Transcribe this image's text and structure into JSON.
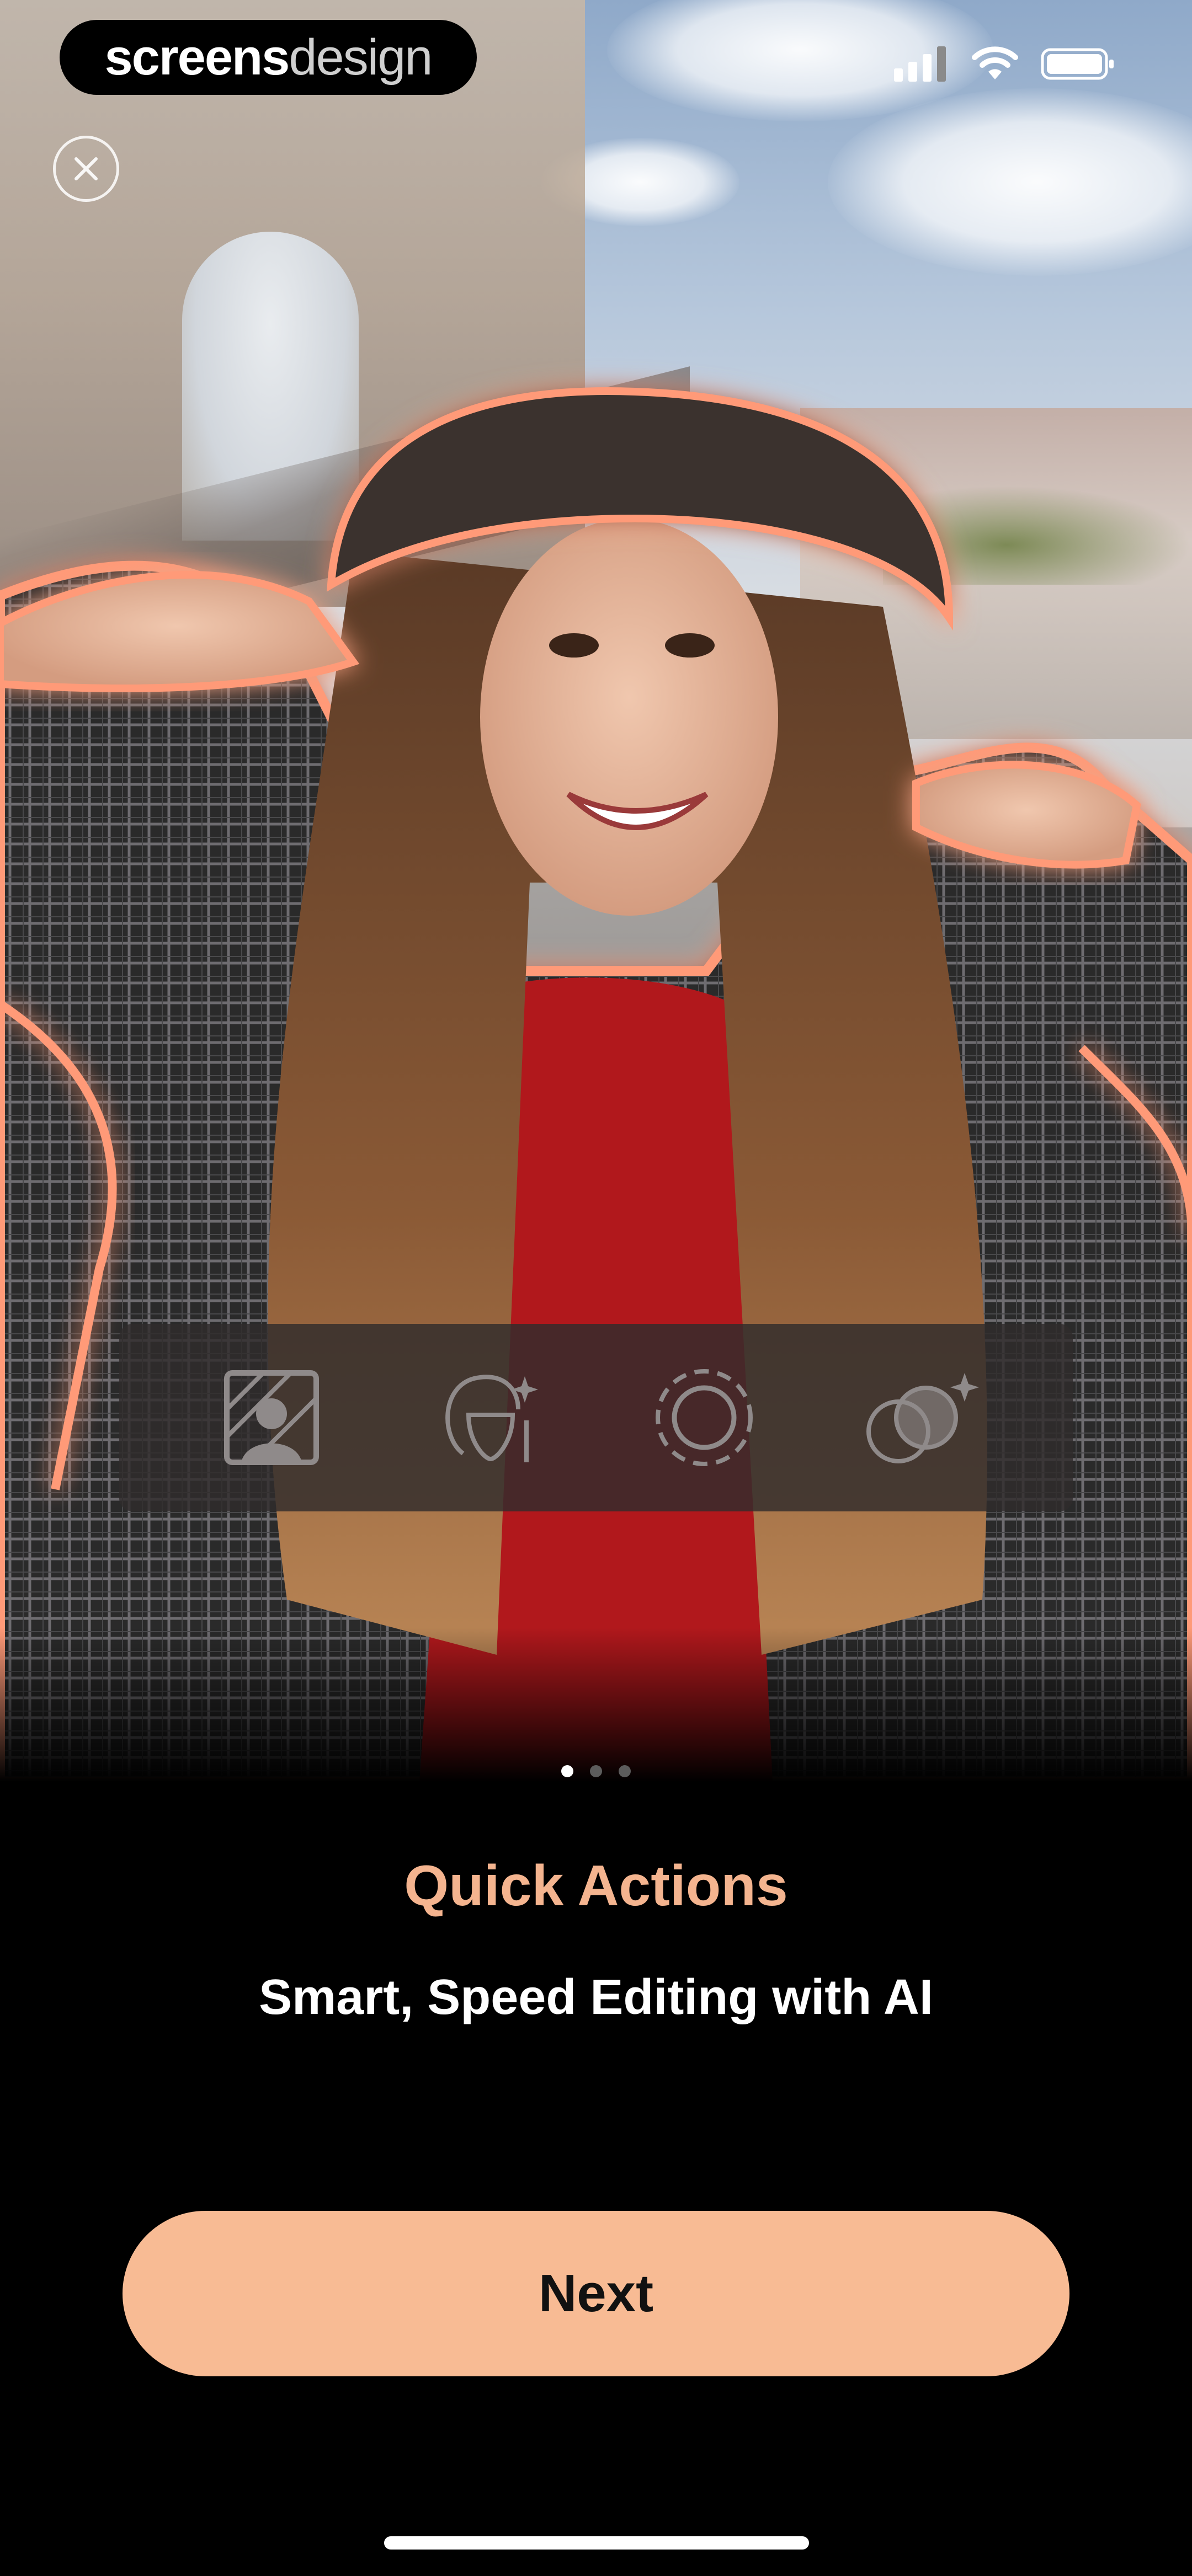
{
  "app": {
    "brand_bold": "screens",
    "brand_light": "design"
  },
  "status_bar": {
    "icons": [
      "signal-icon",
      "wifi-icon",
      "battery-icon"
    ]
  },
  "actions": [
    {
      "icon": "portrait-background-icon"
    },
    {
      "icon": "face-retouch-ai-icon"
    },
    {
      "icon": "blur-circle-icon"
    },
    {
      "icon": "blend-sparkle-icon"
    }
  ],
  "pager": {
    "total": 3,
    "active_index": 0
  },
  "onboarding": {
    "title": "Quick Actions",
    "subtitle": "Smart, Speed Editing with AI",
    "next_label": "Next"
  },
  "colors": {
    "accent": "#f8bb94",
    "title": "#f4b48f",
    "glow": "#ff9a78"
  }
}
